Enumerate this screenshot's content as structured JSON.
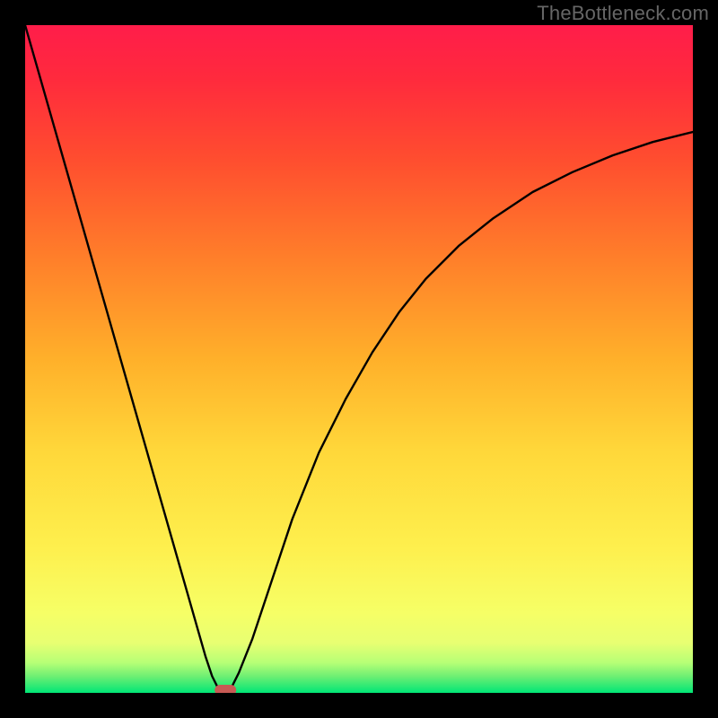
{
  "watermark": "TheBottleneck.com",
  "colors": {
    "top": "#ff1744",
    "upper": "#ff3d3d",
    "mid_high": "#ff7f2a",
    "mid": "#ffc400",
    "mid_low": "#ffe94d",
    "low_yellow": "#f8ff61",
    "green": "#00e676",
    "curve": "#000000",
    "marker": "#c85a54",
    "frame": "#000000"
  },
  "chart_data": {
    "type": "line",
    "title": "",
    "xlabel": "",
    "ylabel": "",
    "xlim": [
      0,
      100
    ],
    "ylim": [
      0,
      100
    ],
    "series": [
      {
        "name": "bottleneck-curve",
        "x": [
          0,
          2,
          4,
          6,
          8,
          10,
          12,
          14,
          16,
          18,
          20,
          22,
          24,
          26,
          27,
          28,
          29,
          30,
          31,
          32,
          34,
          36,
          38,
          40,
          44,
          48,
          52,
          56,
          60,
          65,
          70,
          76,
          82,
          88,
          94,
          100
        ],
        "values": [
          100,
          93,
          86,
          79,
          72,
          65,
          58,
          51,
          44,
          37,
          30,
          23,
          16,
          9,
          5.5,
          2.5,
          0.5,
          0,
          1,
          3,
          8,
          14,
          20,
          26,
          36,
          44,
          51,
          57,
          62,
          67,
          71,
          75,
          78,
          80.5,
          82.5,
          84
        ]
      }
    ],
    "marker": {
      "x": 30,
      "y": 0,
      "label": "optimal-point"
    },
    "gradient_bands": [
      {
        "pos": 0.0,
        "color": "#ff1d4a"
      },
      {
        "pos": 0.08,
        "color": "#ff2a3d"
      },
      {
        "pos": 0.2,
        "color": "#ff4d2f"
      },
      {
        "pos": 0.35,
        "color": "#ff7f2a"
      },
      {
        "pos": 0.5,
        "color": "#ffb02a"
      },
      {
        "pos": 0.64,
        "color": "#ffd83a"
      },
      {
        "pos": 0.78,
        "color": "#feef4d"
      },
      {
        "pos": 0.88,
        "color": "#f6ff66"
      },
      {
        "pos": 0.925,
        "color": "#e8ff72"
      },
      {
        "pos": 0.955,
        "color": "#b6ff76"
      },
      {
        "pos": 0.975,
        "color": "#6fef73"
      },
      {
        "pos": 1.0,
        "color": "#00e676"
      }
    ]
  }
}
